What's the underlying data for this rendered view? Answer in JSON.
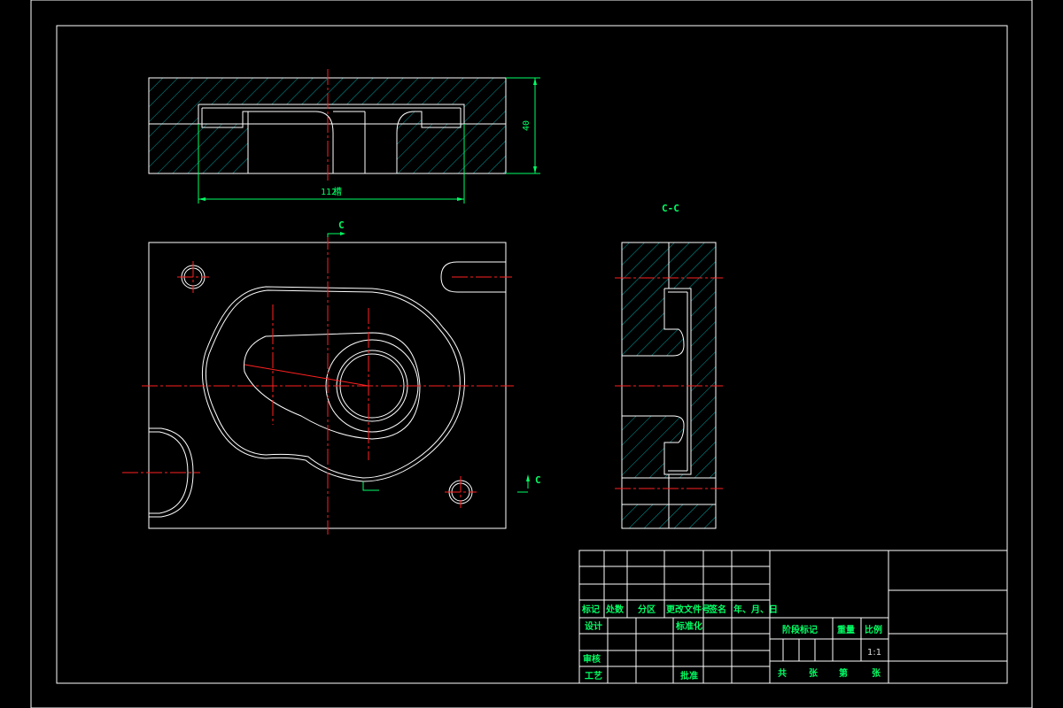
{
  "views": {
    "section_label": "C-C",
    "cut_marker_top": "C",
    "cut_marker_bottom": "C"
  },
  "dimensions": {
    "width": "112",
    "width_note": "槽",
    "height": "40"
  },
  "title_block": {
    "header_row": [
      "标记",
      "处数",
      "分区",
      "更改文件号",
      "签名",
      "年、月、日"
    ],
    "design": "设计",
    "standardize": "标准化",
    "review": "审核",
    "process": "工艺",
    "approve": "批准",
    "stage_mark": "阶段标记",
    "weight": "重量",
    "scale": "比例",
    "scale_value": "1:1",
    "total_sheets": "共",
    "sheets_unit1": "张",
    "sheet_no": "第",
    "sheets_unit2": "张"
  },
  "colors": {
    "background": "#000000",
    "outline": "#ffffff",
    "dimension": "#00ff66",
    "centerline": "#ff2020",
    "hatch": "#00c8c8"
  }
}
